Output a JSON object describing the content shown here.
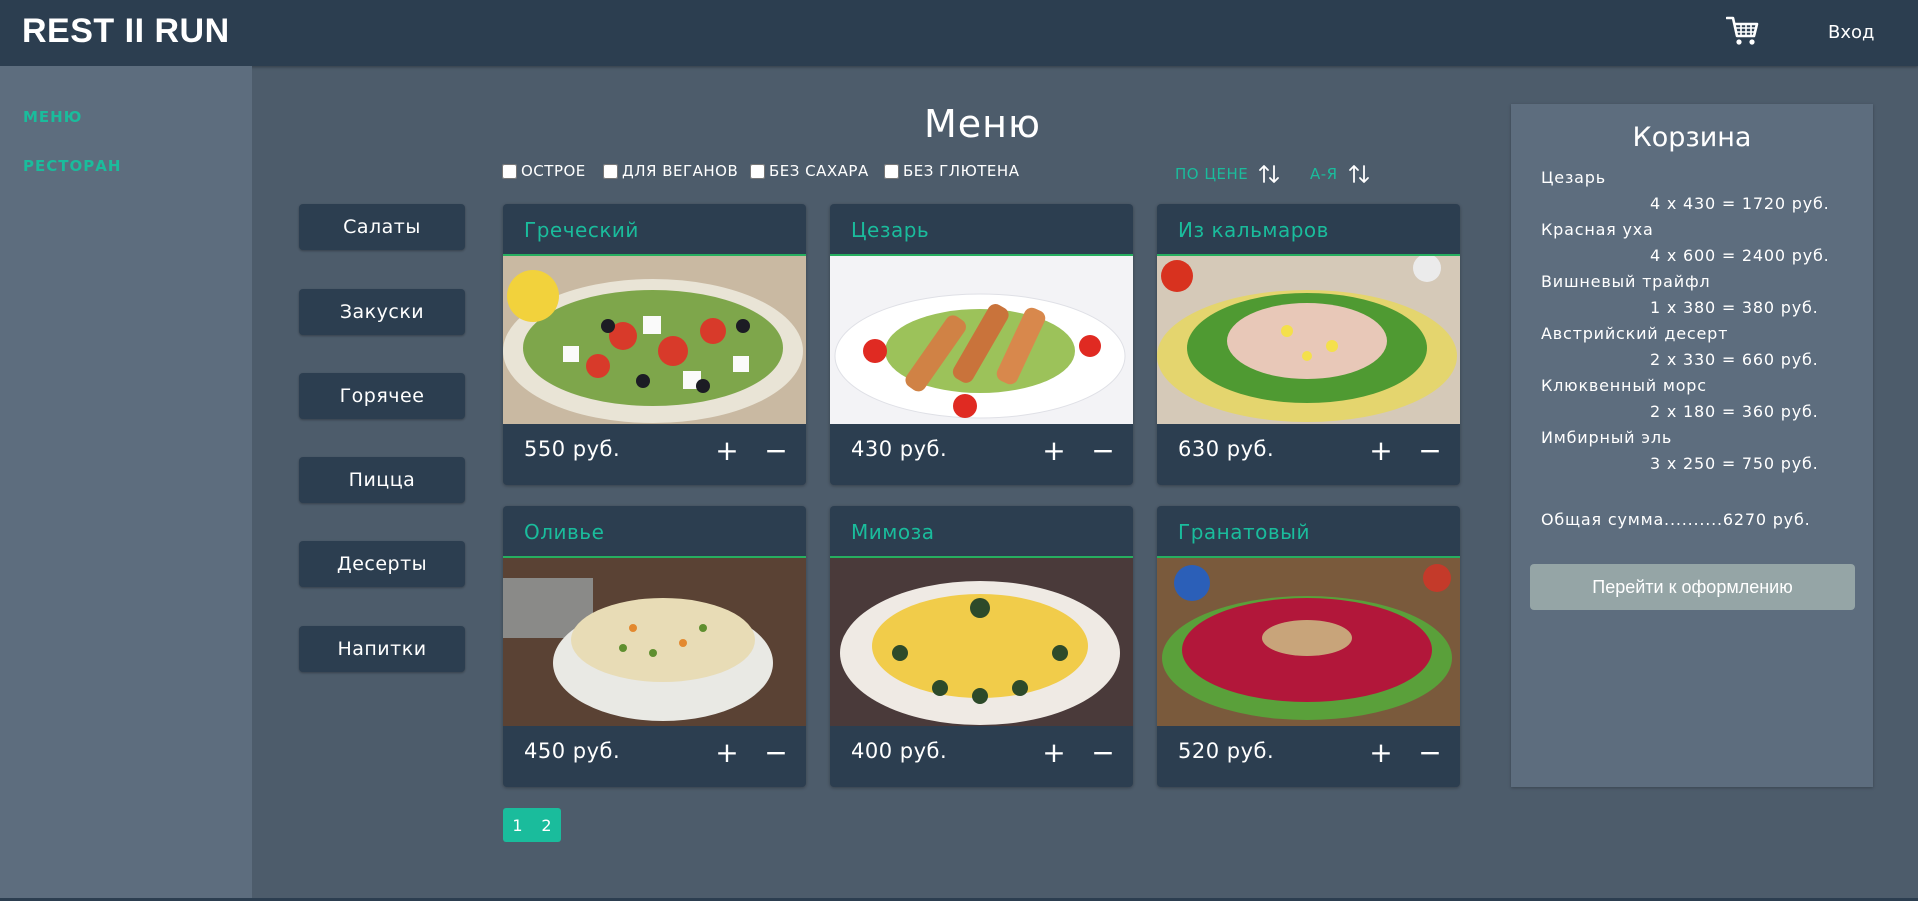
{
  "header": {
    "brand": "REST II RUN",
    "login": "Вход",
    "cart_icon": "shopping-cart-icon"
  },
  "sidebar": {
    "items": [
      {
        "label": "МЕНЮ"
      },
      {
        "label": "РЕСТОРАН"
      }
    ]
  },
  "main": {
    "title": "Меню",
    "filters": [
      {
        "label": "ОСТРОЕ",
        "checked": false
      },
      {
        "label": "ДЛЯ ВЕГАНОВ",
        "checked": false
      },
      {
        "label": "БЕЗ САХАРА",
        "checked": false
      },
      {
        "label": "БЕЗ ГЛЮТЕНА",
        "checked": false
      }
    ],
    "sort": [
      {
        "label": "ПО ЦЕНЕ",
        "icon": "sort-arrows-icon"
      },
      {
        "label": "А-Я",
        "icon": "sort-arrows-icon"
      }
    ],
    "categories": [
      {
        "label": "Салаты"
      },
      {
        "label": "Закуски"
      },
      {
        "label": "Горячее"
      },
      {
        "label": "Пицца"
      },
      {
        "label": "Десерты"
      },
      {
        "label": "Напитки"
      }
    ],
    "dishes": [
      {
        "name": "Греческий",
        "price": "550 руб.",
        "plus": "+",
        "minus": "−",
        "image": "greek-salad-photo"
      },
      {
        "name": "Цезарь",
        "price": "430 руб.",
        "plus": "+",
        "minus": "−",
        "image": "caesar-salad-photo"
      },
      {
        "name": "Из кальмаров",
        "price": "630 руб.",
        "plus": "+",
        "minus": "−",
        "image": "squid-salad-photo"
      },
      {
        "name": "Оливье",
        "price": "450 руб.",
        "plus": "+",
        "minus": "−",
        "image": "olivier-salad-photo"
      },
      {
        "name": "Мимоза",
        "price": "400 руб.",
        "plus": "+",
        "minus": "−",
        "image": "mimosa-salad-photo"
      },
      {
        "name": "Гранатовый",
        "price": "520 руб.",
        "plus": "+",
        "minus": "−",
        "image": "pomegranate-salad-photo"
      }
    ],
    "pagination": {
      "pages": [
        "1",
        "2"
      ]
    }
  },
  "basket": {
    "title": "Корзина",
    "items": [
      {
        "name": "Цезарь",
        "calc": "4 x 430 = 1720 руб."
      },
      {
        "name": "Красная уха",
        "calc": "4 x 600 = 2400 руб."
      },
      {
        "name": "Вишневый трайфл",
        "calc": "1 x 380 = 380 руб."
      },
      {
        "name": "Австрийский десерт",
        "calc": "2 x 330 = 660 руб."
      },
      {
        "name": "Клюквенный морс",
        "calc": "2 x 180 = 360 руб."
      },
      {
        "name": "Имбирный эль",
        "calc": "3 x 250 = 750 руб."
      }
    ],
    "total": "Общая сумма..........6270 руб.",
    "checkout_label": "Перейти к оформлению"
  },
  "colors": {
    "header": "#2c3e50",
    "background": "#4d5c6b",
    "panel": "#5d6d7e",
    "accent": "#1abc9c",
    "button": "#95a5a6"
  }
}
